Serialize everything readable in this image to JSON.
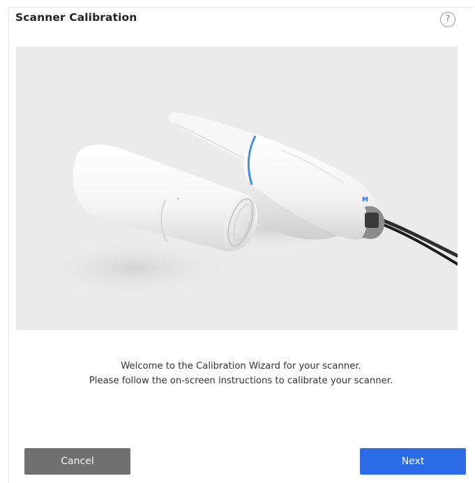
{
  "dialog": {
    "title": "Scanner Calibration",
    "help_icon": "question-circle-icon",
    "help_glyph": "?"
  },
  "illustration": {
    "description_icon": "scanner-and-calibration-tube-image",
    "background_color": "#ebebeb"
  },
  "message": {
    "line1": "Welcome to the Calibration Wizard for your scanner.",
    "line2": "Please follow the on-screen instructions to calibrate your scanner."
  },
  "footer": {
    "cancel_label": "Cancel",
    "next_label": "Next",
    "cancel_color": "#707070",
    "next_color": "#2b6be6"
  }
}
